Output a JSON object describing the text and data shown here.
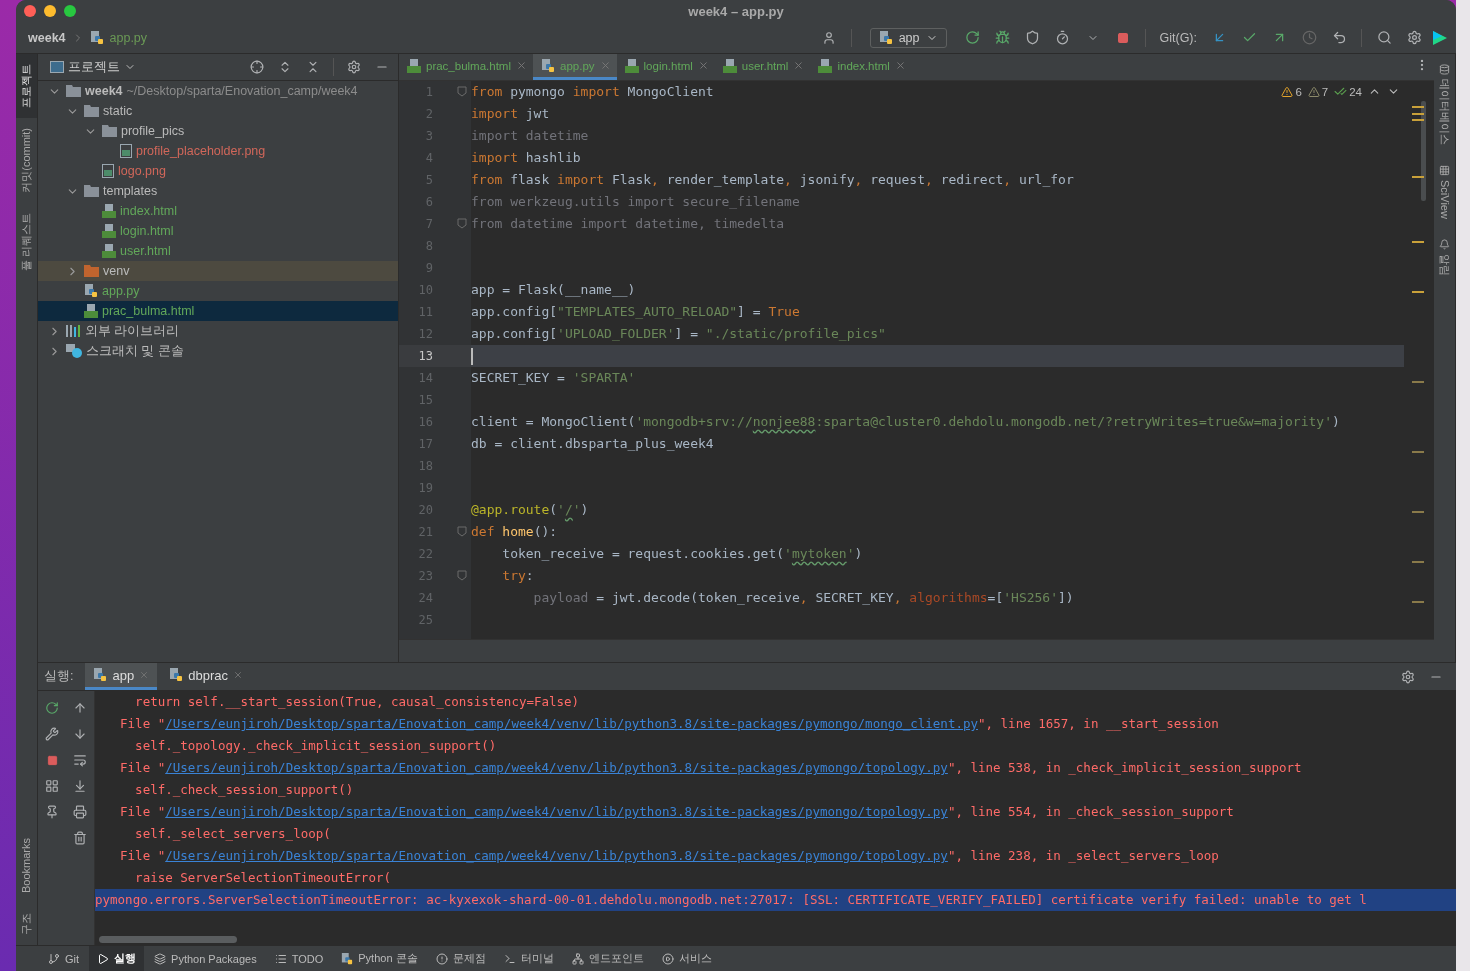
{
  "window": {
    "title": "week4 – app.py"
  },
  "breadcrumb": [
    {
      "label": "week4",
      "kind": "project"
    },
    {
      "label": "app.py",
      "kind": "python"
    }
  ],
  "toolbar": {
    "run_config": "app",
    "git_label": "Git(G):"
  },
  "left_strip": [
    {
      "label": "프로젝트",
      "selected": true
    },
    {
      "label": "커밋(commit)",
      "selected": false
    },
    {
      "label": "풀 리퀘스트",
      "selected": false
    }
  ],
  "left_strip_bottom": [
    {
      "label": "Bookmarks"
    },
    {
      "label": "구조"
    }
  ],
  "right_strip": [
    {
      "label": "데이터베이스",
      "kind": "database"
    },
    {
      "label": "SciView",
      "kind": "sciview"
    },
    {
      "label": "알림",
      "kind": "bell"
    }
  ],
  "project_panel": {
    "title": "프로젝트",
    "tree": [
      {
        "label": "week4",
        "path": "~/Desktop/sparta/Enovation_camp/week4",
        "kind": "folder",
        "color": "#bbbbbb",
        "expanded": true,
        "selected": false,
        "children": [
          {
            "label": "static",
            "kind": "folder",
            "color": "#bbbbbb",
            "expanded": true,
            "selected": false,
            "children": [
              {
                "label": "profile_pics",
                "kind": "folder",
                "color": "#bbbbbb",
                "expanded": true,
                "selected": false,
                "children": [
                  {
                    "label": "profile_placeholder.png",
                    "kind": "image",
                    "color": "#d1675a",
                    "selected": false
                  }
                ]
              },
              {
                "label": "logo.png",
                "kind": "image",
                "color": "#d1675a",
                "selected": false
              }
            ]
          },
          {
            "label": "templates",
            "kind": "folder",
            "color": "#bbbbbb",
            "expanded": true,
            "selected": false,
            "children": [
              {
                "label": "index.html",
                "kind": "html",
                "color": "#62a85a",
                "selected": false
              },
              {
                "label": "login.html",
                "kind": "html",
                "color": "#62a85a",
                "selected": false
              },
              {
                "label": "user.html",
                "kind": "html",
                "color": "#62a85a",
                "selected": false
              }
            ]
          },
          {
            "label": "venv",
            "kind": "excluded-folder",
            "color": "#bbbbbb",
            "expanded": false,
            "selected": false
          },
          {
            "label": "app.py",
            "kind": "python",
            "color": "#62a85a",
            "selected": false
          },
          {
            "label": "prac_bulma.html",
            "kind": "html",
            "color": "#62a85a",
            "selected": true
          }
        ]
      },
      {
        "label": "외부 라이브러리",
        "kind": "library",
        "color": "#bbbbbb",
        "expanded": false,
        "selected": false
      },
      {
        "label": "스크래치 및 콘솔",
        "kind": "scratch",
        "color": "#bbbbbb",
        "expanded": false,
        "selected": false
      }
    ]
  },
  "editor_tabs": [
    {
      "label": "prac_bulma.html",
      "kind": "html",
      "selected": false
    },
    {
      "label": "app.py",
      "kind": "python",
      "selected": true
    },
    {
      "label": "login.html",
      "kind": "html",
      "selected": false
    },
    {
      "label": "user.html",
      "kind": "html",
      "selected": false
    },
    {
      "label": "index.html",
      "kind": "html",
      "selected": false
    }
  ],
  "inspections": [
    {
      "kind": "warning",
      "count": "6"
    },
    {
      "kind": "weak-warning",
      "count": "7"
    },
    {
      "kind": "typo",
      "count": "24"
    }
  ],
  "code": [
    {
      "no": "1",
      "fold": true,
      "current": false,
      "tokens": [
        {
          "kind": "kw",
          "text": "from"
        },
        {
          "kind": "p",
          "text": " pymongo "
        },
        {
          "kind": "kw",
          "text": "import"
        },
        {
          "kind": "p",
          "text": " MongoClient"
        }
      ]
    },
    {
      "no": "2",
      "fold": false,
      "current": false,
      "tokens": [
        {
          "kind": "kw",
          "text": "import"
        },
        {
          "kind": "p",
          "text": " jwt"
        }
      ]
    },
    {
      "no": "3",
      "fold": false,
      "current": false,
      "tokens": [
        {
          "kind": "dim",
          "text": "import datetime"
        }
      ]
    },
    {
      "no": "4",
      "fold": false,
      "current": false,
      "tokens": [
        {
          "kind": "kw",
          "text": "import"
        },
        {
          "kind": "p",
          "text": " hashlib"
        }
      ]
    },
    {
      "no": "5",
      "fold": false,
      "current": false,
      "tokens": [
        {
          "kind": "kw",
          "text": "from"
        },
        {
          "kind": "p",
          "text": " flask "
        },
        {
          "kind": "kw",
          "text": "import"
        },
        {
          "kind": "p",
          "text": " Flask"
        },
        {
          "kind": "kw",
          "text": ","
        },
        {
          "kind": "p",
          "text": " render_template"
        },
        {
          "kind": "kw",
          "text": ","
        },
        {
          "kind": "p",
          "text": " jsonify"
        },
        {
          "kind": "kw",
          "text": ","
        },
        {
          "kind": "p",
          "text": " request"
        },
        {
          "kind": "kw",
          "text": ","
        },
        {
          "kind": "p",
          "text": " redirect"
        },
        {
          "kind": "kw",
          "text": ","
        },
        {
          "kind": "p",
          "text": " url_for"
        }
      ]
    },
    {
      "no": "6",
      "fold": false,
      "current": false,
      "tokens": [
        {
          "kind": "dim",
          "text": "from werkzeug.utils import secure_filename"
        }
      ]
    },
    {
      "no": "7",
      "fold": true,
      "current": false,
      "tokens": [
        {
          "kind": "dim",
          "text": "from datetime import datetime, timedelta"
        }
      ]
    },
    {
      "no": "8",
      "fold": false,
      "current": false
    },
    {
      "no": "9",
      "fold": false,
      "current": false
    },
    {
      "no": "10",
      "fold": false,
      "current": false,
      "tokens": [
        {
          "kind": "p",
          "text": "app = Flask(__name__)"
        }
      ]
    },
    {
      "no": "11",
      "fold": false,
      "current": false,
      "tokens": [
        {
          "kind": "p",
          "text": "app.config["
        },
        {
          "kind": "str",
          "text": "\"TEMPLATES_AUTO_RELOAD\""
        },
        {
          "kind": "p",
          "text": "] = "
        },
        {
          "kind": "kw",
          "text": "True"
        }
      ]
    },
    {
      "no": "12",
      "fold": false,
      "current": false,
      "tokens": [
        {
          "kind": "p",
          "text": "app.config["
        },
        {
          "kind": "str",
          "text": "'UPLOAD_FOLDER'"
        },
        {
          "kind": "p",
          "text": "] = "
        },
        {
          "kind": "str",
          "text": "\"./static/profile_pics\""
        }
      ]
    },
    {
      "no": "13",
      "fold": false,
      "current": true
    },
    {
      "no": "14",
      "fold": false,
      "current": false,
      "tokens": [
        {
          "kind": "p",
          "text": "SECRET_KEY = "
        },
        {
          "kind": "str",
          "text": "'SPARTA'"
        }
      ]
    },
    {
      "no": "15",
      "fold": false,
      "current": false
    },
    {
      "no": "16",
      "fold": false,
      "current": false,
      "tokens": [
        {
          "kind": "p",
          "text": "client = MongoClient("
        },
        {
          "kind": "str",
          "text": "'mongodb+srv://"
        },
        {
          "kind": "typo",
          "text": "nonjee88"
        },
        {
          "kind": "str",
          "text": ":sparta@cluster0.dehdolu.mongodb.net/?retryWrites=true&w=majority'"
        },
        {
          "kind": "p",
          "text": ")"
        }
      ]
    },
    {
      "no": "17",
      "fold": false,
      "current": false,
      "tokens": [
        {
          "kind": "p",
          "text": "db = client.dbsparta_plus_week4"
        }
      ]
    },
    {
      "no": "18",
      "fold": false,
      "current": false
    },
    {
      "no": "19",
      "fold": false,
      "current": false
    },
    {
      "no": "20",
      "fold": false,
      "current": false,
      "tokens": [
        {
          "kind": "deco",
          "text": "@app.route"
        },
        {
          "kind": "p",
          "text": "("
        },
        {
          "kind": "str",
          "text": "'"
        },
        {
          "kind": "typo",
          "text": "/"
        },
        {
          "kind": "str",
          "text": "'"
        },
        {
          "kind": "p",
          "text": ")"
        }
      ]
    },
    {
      "no": "21",
      "fold": true,
      "current": false,
      "tokens": [
        {
          "kind": "kw",
          "text": "def"
        },
        {
          "kind": "fn",
          "text": " home"
        },
        {
          "kind": "p",
          "text": "():"
        }
      ]
    },
    {
      "no": "22",
      "fold": false,
      "current": false,
      "tokens": [
        {
          "kind": "p",
          "text": "    token_receive = request.cookies.get("
        },
        {
          "kind": "str",
          "text": "'"
        },
        {
          "kind": "typo",
          "text": "mytoken"
        },
        {
          "kind": "str",
          "text": "'"
        },
        {
          "kind": "p",
          "text": ")"
        }
      ]
    },
    {
      "no": "23",
      "fold": true,
      "current": false,
      "tokens": [
        {
          "kind": "kw",
          "text": "    try"
        },
        {
          "kind": "p",
          "text": ":"
        }
      ]
    },
    {
      "no": "24",
      "fold": false,
      "current": false,
      "tokens": [
        {
          "kind": "dim",
          "text": "        payload"
        },
        {
          "kind": "p",
          "text": " = jwt.decode(token_receive"
        },
        {
          "kind": "kw",
          "text": ","
        },
        {
          "kind": "p",
          "text": " SECRET_KEY"
        },
        {
          "kind": "kw",
          "text": ","
        },
        {
          "kind": "param",
          "text": " algorithms"
        },
        {
          "kind": "p",
          "text": "=["
        },
        {
          "kind": "str",
          "text": "'HS256'"
        },
        {
          "kind": "p",
          "text": "])"
        }
      ]
    },
    {
      "no": "25",
      "fold": false,
      "current": false
    }
  ],
  "run_panel": {
    "label": "실행:",
    "tabs": [
      {
        "label": "app",
        "selected": true
      },
      {
        "label": "dbprac",
        "selected": false
      }
    ],
    "lines": [
      {
        "kind": "code",
        "selected": false,
        "text": "    return self.__start_session(True, causal_consistency=False)"
      },
      {
        "kind": "file",
        "selected": false,
        "prefix": "  File \"",
        "path": "/Users/eunjiroh/Desktop/sparta/Enovation_camp/week4/venv/lib/python3.8/site-packages/pymongo/mongo_client.py",
        "suffix": "\", line 1657, in __start_session"
      },
      {
        "kind": "code",
        "selected": false,
        "text": "    self._topology._check_implicit_session_support()"
      },
      {
        "kind": "file",
        "selected": false,
        "prefix": "  File \"",
        "path": "/Users/eunjiroh/Desktop/sparta/Enovation_camp/week4/venv/lib/python3.8/site-packages/pymongo/topology.py",
        "suffix": "\", line 538, in _check_implicit_session_support"
      },
      {
        "kind": "code",
        "selected": false,
        "text": "    self._check_session_support()"
      },
      {
        "kind": "file",
        "selected": false,
        "prefix": "  File \"",
        "path": "/Users/eunjiroh/Desktop/sparta/Enovation_camp/week4/venv/lib/python3.8/site-packages/pymongo/topology.py",
        "suffix": "\", line 554, in _check_session_support"
      },
      {
        "kind": "code",
        "selected": false,
        "text": "    self._select_servers_loop("
      },
      {
        "kind": "file",
        "selected": false,
        "prefix": "  File \"",
        "path": "/Users/eunjiroh/Desktop/sparta/Enovation_camp/week4/venv/lib/python3.8/site-packages/pymongo/topology.py",
        "suffix": "\", line 238, in _select_servers_loop"
      },
      {
        "kind": "code",
        "selected": false,
        "text": "    raise ServerSelectionTimeoutError("
      },
      {
        "kind": "code",
        "selected": true,
        "text": "pymongo.errors.ServerSelectionTimeoutError: ac-kyxexok-shard-00-01.dehdolu.mongodb.net:27017: [SSL: CERTIFICATE_VERIFY_FAILED] certificate verify failed: unable to get l"
      }
    ]
  },
  "status_bar": [
    {
      "label": "Git",
      "kind": "git",
      "selected": false
    },
    {
      "label": "실행",
      "kind": "run",
      "selected": true
    },
    {
      "label": "Python Packages",
      "kind": "packages",
      "selected": false
    },
    {
      "label": "TODO",
      "kind": "todo",
      "selected": false
    },
    {
      "label": "Python 콘솔",
      "kind": "console",
      "selected": false
    },
    {
      "label": "문제점",
      "kind": "problems",
      "selected": false
    },
    {
      "label": "터미널",
      "kind": "terminal",
      "selected": false
    },
    {
      "label": "엔드포인트",
      "kind": "endpoints",
      "selected": false
    },
    {
      "label": "서비스",
      "kind": "services",
      "selected": false
    }
  ]
}
